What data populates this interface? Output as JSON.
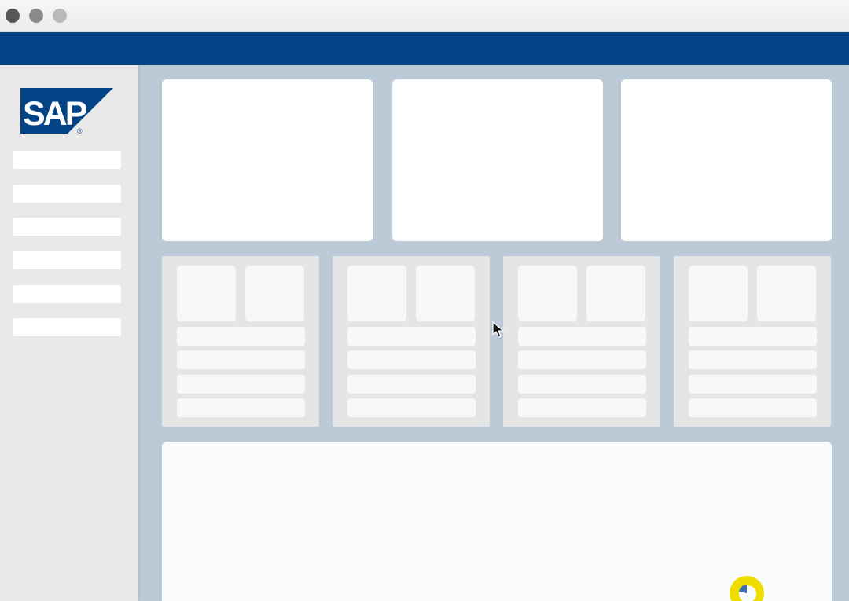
{
  "window": {
    "controls": [
      "close",
      "minimize",
      "maximize"
    ]
  },
  "brand": {
    "logo_text": "SAP",
    "registered_mark": "®",
    "logo_color": "#024386"
  },
  "shell": {
    "bar_color": "#024386"
  },
  "colors": {
    "content_background": "#bccad8",
    "sidebar_background": "#e9e9e9",
    "loader_accent": "#f0dd00"
  },
  "sidebar": {
    "items": [
      "",
      "",
      "",
      "",
      "",
      ""
    ]
  },
  "main": {
    "large_tiles": 3,
    "cards": 4,
    "card_rows_per_card": 4
  },
  "icons": {
    "cursor": "arrow-cursor-icon",
    "loader": "loading-indicator-icon"
  }
}
